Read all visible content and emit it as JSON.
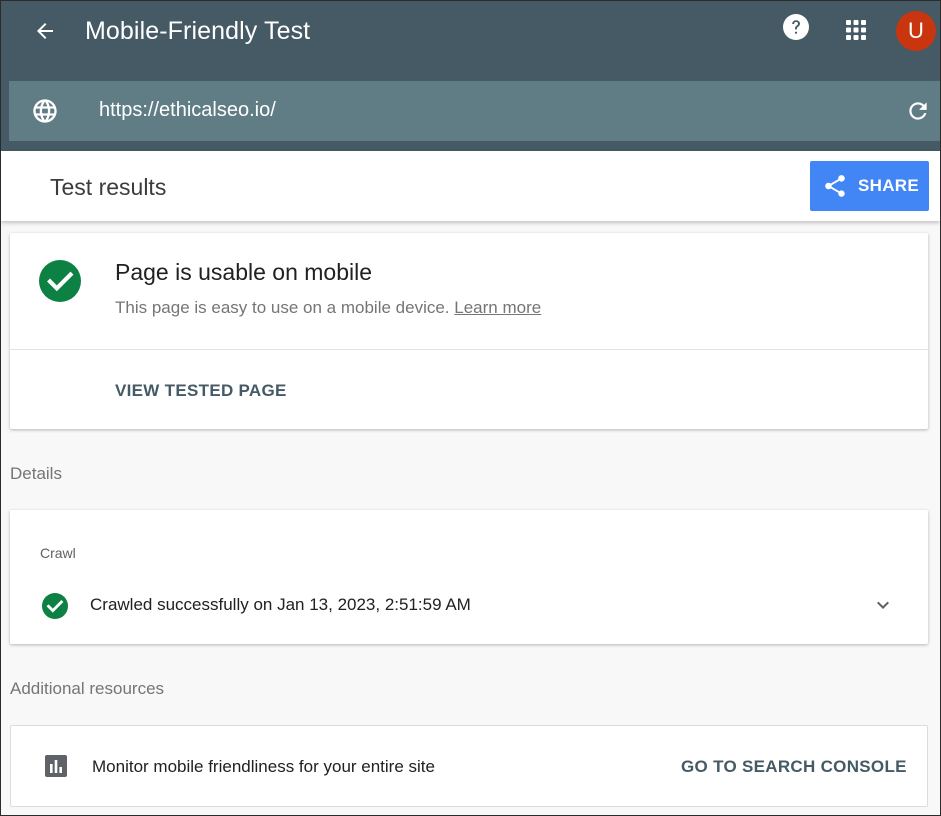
{
  "appbar": {
    "title": "Mobile-Friendly Test",
    "avatar_initial": "U"
  },
  "urlbar": {
    "url": "https://ethicalseo.io/"
  },
  "results": {
    "title": "Test results",
    "share_label": "SHARE"
  },
  "result_card": {
    "title": "Page is usable on mobile",
    "description": "This page is easy to use on a mobile device.",
    "learn_more": "Learn more",
    "view_tested": "VIEW TESTED PAGE"
  },
  "details": {
    "section_label": "Details",
    "crawl_label": "Crawl",
    "crawl_status": "Crawled successfully on Jan 13, 2023, 2:51:59 AM"
  },
  "resources": {
    "section_label": "Additional resources",
    "monitor_text": "Monitor mobile friendliness for your entire site",
    "console_button": "GO TO SEARCH CONSOLE"
  },
  "icons": {
    "back": "arrow-back-icon",
    "help": "help-icon",
    "apps": "apps-grid-icon",
    "globe": "globe-icon",
    "refresh": "refresh-icon",
    "share": "share-icon",
    "success": "check-circle-icon",
    "expand": "chevron-down-icon",
    "chart": "bar-chart-icon"
  },
  "colors": {
    "appbar": "#455a64",
    "urlbar": "#607d86",
    "share_button": "#4285f4",
    "success_green": "#0d8043",
    "avatar": "#c8350e"
  }
}
